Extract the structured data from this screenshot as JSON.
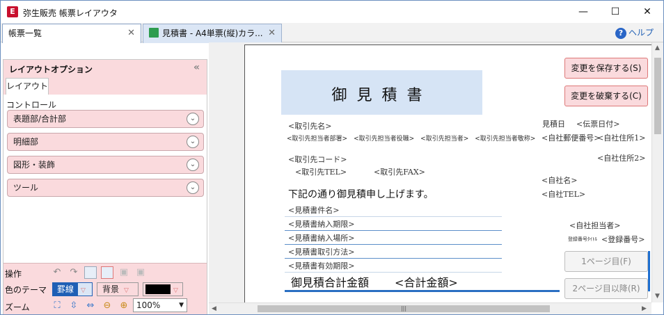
{
  "app": {
    "title": "弥生販売 帳票レイアウタ",
    "icon_text": "E"
  },
  "window_controls": {
    "minimize": "—",
    "maximize": "☐",
    "close": "✕"
  },
  "tabs": [
    {
      "label": "帳票一覧",
      "close": "✕"
    },
    {
      "label": "見積書 - A4単票(縦)カラ...",
      "close": "✕"
    }
  ],
  "help": {
    "label": "ヘルプ",
    "icon": "?"
  },
  "left_panel": {
    "title": "レイアウトオプション",
    "collapse": "«",
    "subtab": "レイアウト",
    "controls_label": "コントロール",
    "sections": [
      "表題部/合計部",
      "明細部",
      "図形・装飾",
      "ツール"
    ],
    "ops_label": "操作",
    "color_theme_label": "色のテーマ",
    "border_label": "罫線",
    "background_label": "背景",
    "zoom_label": "ズーム",
    "zoom_value": "100%",
    "fill_color": "#000000"
  },
  "document": {
    "title": "御見積書",
    "customer_name": "<取引先名>",
    "customer_contact_line": "<取引先担当者部署>　<取引先担当者役職>　<取引先担当者>　<取引先担当者敬称>",
    "customer_code": "<取引先コード>",
    "customer_tel": "<取引先TEL>",
    "customer_fax": "<取引先FAX>",
    "greeting": "下記の通り御見積申し上げます。",
    "subject": "<見積書件名>",
    "delivery_deadline": "<見積書納入期限>",
    "delivery_place": "<見積書納入場所>",
    "trade_method": "<見積書取引方法>",
    "valid_period": "<見積書有効期限>",
    "total_label": "御見積合計金額",
    "total_value": "<合計金額>",
    "estimate_date_label": "見積日",
    "estimate_date": "<伝票日付>",
    "company_postal": "<自社郵便番号>",
    "company_address1": "<自社住所1>",
    "company_address2": "<自社住所2>",
    "company_name": "<自社名>",
    "company_tel": "<自社TEL>",
    "company_rep": "<自社担当者>",
    "reg_small": "登録番号ﾀｲﾄﾙ",
    "reg_number": "<登録番号>"
  },
  "buttons": {
    "save": "変更を保存する(S)",
    "discard": "変更を破棄する(C)",
    "page1": "1ページ目(F)",
    "page2": "2ページ目以降(R)"
  },
  "scrollbar": {
    "grip": "|||"
  }
}
